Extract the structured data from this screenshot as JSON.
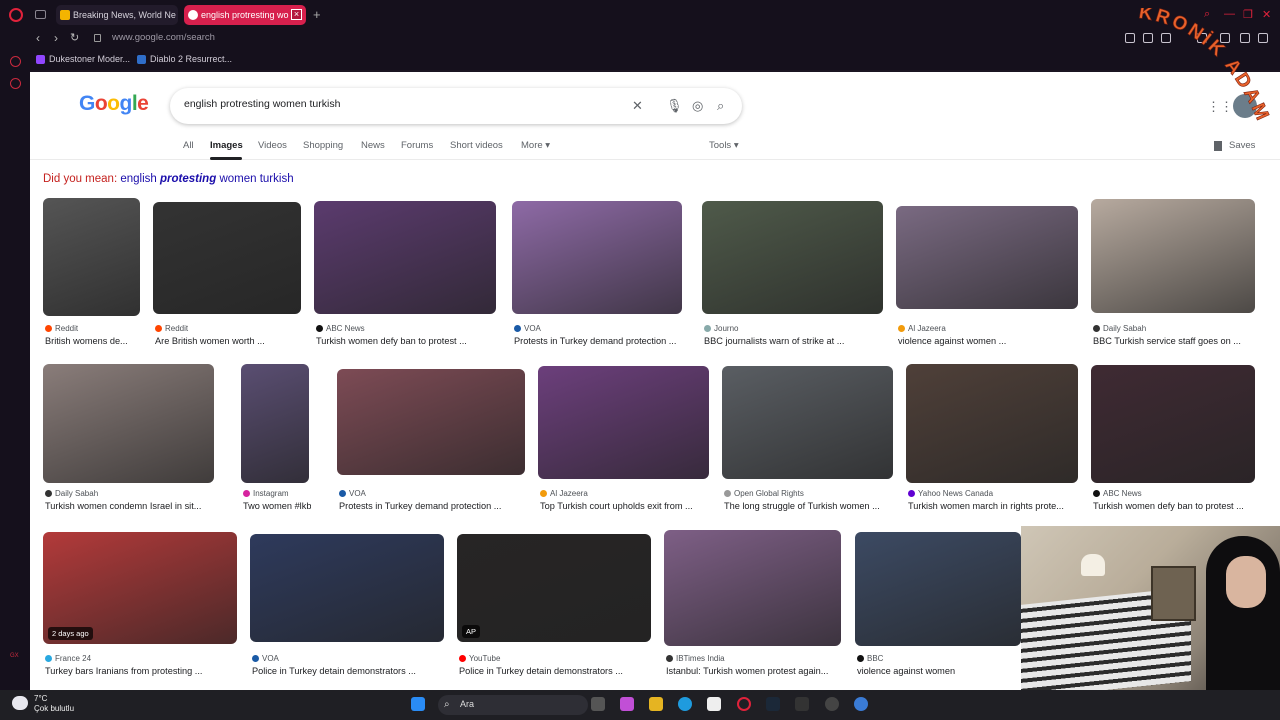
{
  "browser": {
    "tabs": [
      {
        "title": "Breaking News, World Ne",
        "active": false
      },
      {
        "title": "english protresting wo",
        "active": true
      }
    ],
    "url": "www.google.com/search",
    "bookmarks": [
      "Dukestoner Moder...",
      "Diablo 2 Resurrect..."
    ],
    "accent": "#d7204d"
  },
  "search": {
    "query": "english protresting women turkish",
    "tabs": [
      "All",
      "Images",
      "Videos",
      "Shopping",
      "News",
      "Forums",
      "Short videos",
      "More"
    ],
    "active_tab": "Images",
    "tools_label": "Tools",
    "saves_label": "Saves",
    "did_you_mean_prefix": "Did you mean:",
    "did_you_mean_before": "english",
    "did_you_mean_bold": "protesting",
    "did_you_mean_after": "women turkish"
  },
  "results": [
    {
      "source": "Reddit",
      "caption": "British womens de...",
      "color": "#555",
      "src_color": "#ff4500"
    },
    {
      "source": "Reddit",
      "caption": "Are British women worth ...",
      "color": "#333",
      "src_color": "#ff4500"
    },
    {
      "source": "ABC News",
      "caption": "Turkish women defy ban to protest ...",
      "color": "#5b3b6e",
      "src_color": "#111"
    },
    {
      "source": "VOA",
      "caption": "Protests in Turkey demand protection ...",
      "color": "#8e6aa6",
      "src_color": "#1a5aa6"
    },
    {
      "source": "Journo",
      "caption": "BBC journalists warn of strike at ...",
      "color": "#4f5a4a",
      "src_color": "#8aa"
    },
    {
      "source": "Al Jazeera",
      "caption": "violence against women ...",
      "color": "#7a6a82",
      "src_color": "#f29b0c"
    },
    {
      "source": "Daily Sabah",
      "caption": "BBC Turkish service staff goes on ...",
      "color": "#b7aa9f",
      "src_color": "#333"
    },
    {
      "source": "Daily Sabah",
      "caption": "Turkish women condemn Israel in sit...",
      "color": "#8a7d7a",
      "src_color": "#333"
    },
    {
      "source": "Instagram",
      "caption": "Two women #lkbal...",
      "color": "#5a4e72",
      "src_color": "#d6249f"
    },
    {
      "source": "VOA",
      "caption": "Protests in Turkey demand protection ...",
      "color": "#7d4b55",
      "src_color": "#1a5aa6"
    },
    {
      "source": "Al Jazeera",
      "caption": "Top Turkish court upholds exit from ...",
      "color": "#6c3f7c",
      "src_color": "#f29b0c"
    },
    {
      "source": "Open Global Rights",
      "caption": "The long struggle of Turkish women ...",
      "color": "#5a5e63",
      "src_color": "#999"
    },
    {
      "source": "Yahoo News Canada",
      "caption": "Turkish women march in rights prote...",
      "color": "#4f4039",
      "src_color": "#6001d2"
    },
    {
      "source": "ABC News",
      "caption": "Turkish women defy ban to protest ...",
      "color": "#3f2a33",
      "src_color": "#111"
    },
    {
      "source": "France 24",
      "caption": "Turkey bars Iranians from protesting ...",
      "color": "#b33a3a",
      "src_color": "#29a8e0",
      "badge": "2 days ago"
    },
    {
      "source": "VOA",
      "caption": "Police in Turkey detain demonstrators ...",
      "color": "#2e3a5c",
      "src_color": "#1a5aa6"
    },
    {
      "source": "YouTube",
      "caption": "Police in Turkey detain demonstrators ...",
      "color": "#272525",
      "src_color": "#ff0000",
      "badge": "AP"
    },
    {
      "source": "IBTimes India",
      "caption": "Istanbul: Turkish women protest again...",
      "color": "#7e5f86",
      "src_color": "#333"
    },
    {
      "source": "BBC",
      "caption": "violence against women",
      "color": "#3c4a63",
      "src_color": "#111"
    }
  ],
  "taskbar": {
    "temperature": "7°C",
    "weather": "Çok bulutlu",
    "search_placeholder": "Ara"
  },
  "watermark": "KRONİK ADAM"
}
